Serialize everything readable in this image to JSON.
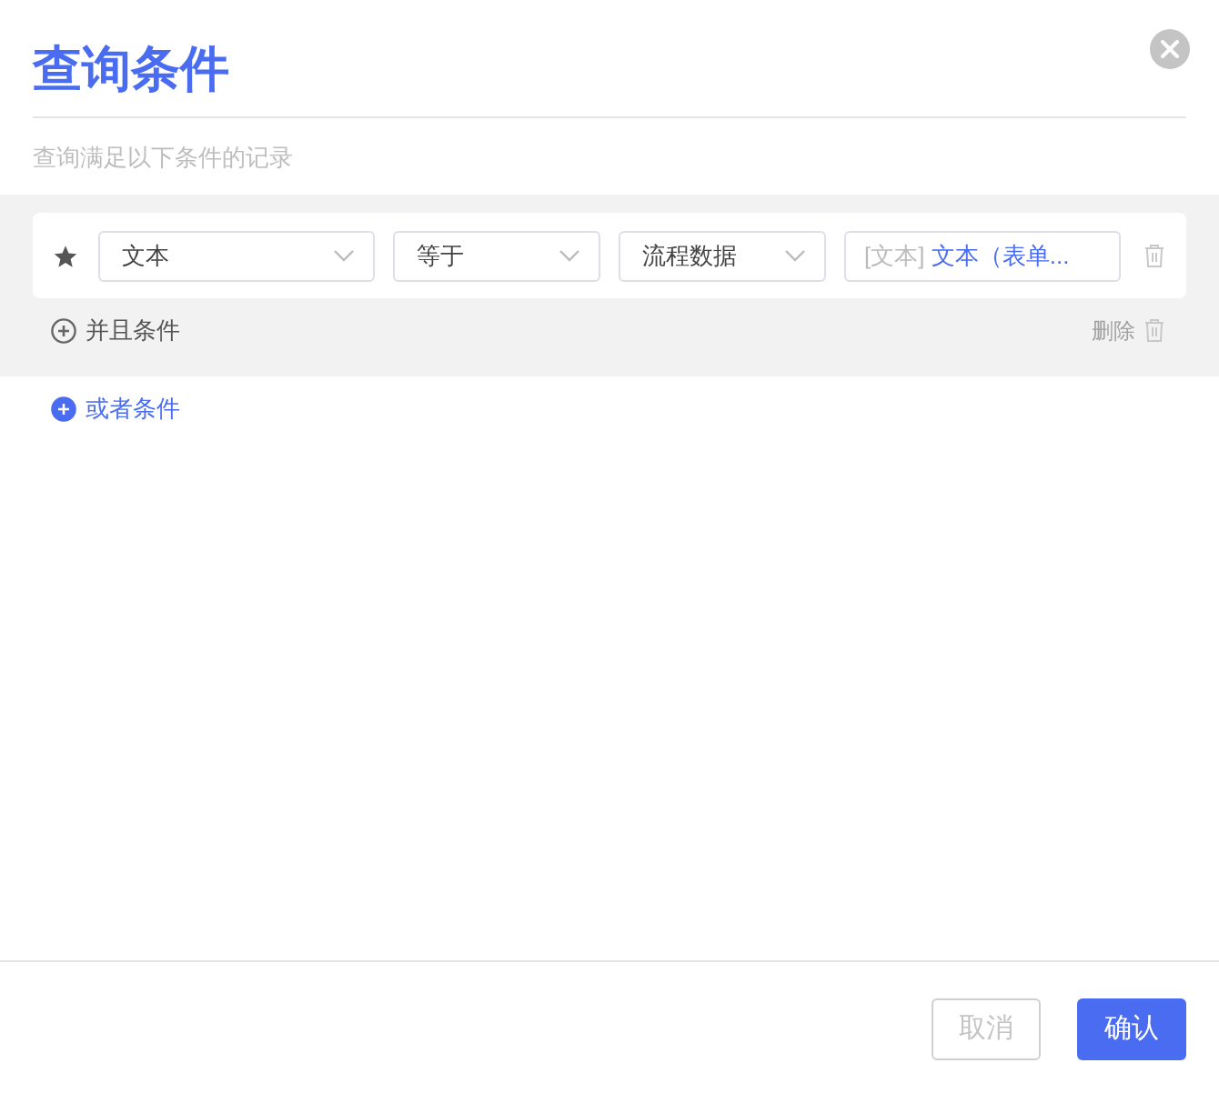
{
  "title": "查询条件",
  "subtitle": "查询满足以下条件的记录",
  "groups": [
    {
      "conditions": [
        {
          "field": "文本",
          "operator": "等于",
          "source": "流程数据",
          "value_type": "[文本]",
          "value": "文本（表单..."
        }
      ],
      "add_and_label": "并且条件",
      "delete_label": "删除"
    }
  ],
  "add_or_label": "或者条件",
  "buttons": [
    {
      "label": "取消",
      "kind": "secondary",
      "disabled": true
    },
    {
      "label": "确认",
      "kind": "primary",
      "disabled": false
    }
  ]
}
